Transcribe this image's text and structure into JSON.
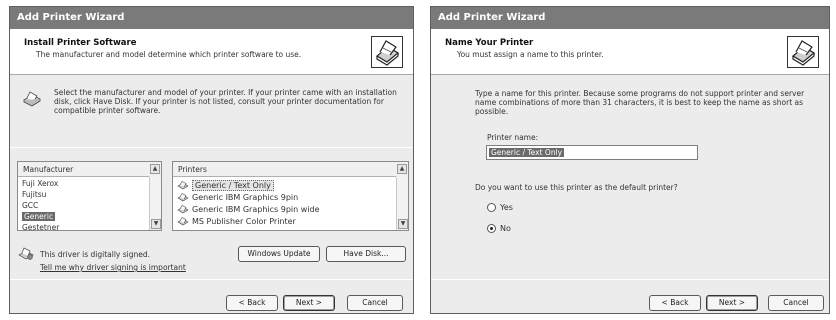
{
  "left": {
    "title": "Add Printer Wizard",
    "header_title": "Install Printer Software",
    "header_sub": "The manufacturer and model determine which printer software to use.",
    "instructions": "Select the manufacturer and model of your printer. If your printer came with an installation disk, click Have Disk. If your printer is not listed, consult your printer documentation for compatible printer software.",
    "manufacturer_header": "Manufacturer",
    "manufacturers": [
      "Fuji Xerox",
      "Fujitsu",
      "GCC",
      "Generic",
      "Gestetner"
    ],
    "selected_manufacturer": "Generic",
    "printers_header": "Printers",
    "printers": [
      "Generic / Text Only",
      "Generic IBM Graphics 9pin",
      "Generic IBM Graphics 9pin wide",
      "MS Publisher Color Printer"
    ],
    "selected_printer": "Generic / Text Only",
    "signed_text": "This driver is digitally signed.",
    "signing_link": "Tell me why driver signing is important",
    "windows_update_label": "Windows Update",
    "have_disk_label": "Have Disk...",
    "back_label": "< Back",
    "next_label": "Next >",
    "cancel_label": "Cancel"
  },
  "right": {
    "title": "Add Printer Wizard",
    "header_title": "Name Your Printer",
    "header_sub": "You must assign a name to this printer.",
    "instructions": "Type a name for this printer. Because some programs do not support printer and server name combinations of more than 31 characters, it is best to keep the name as short as possible.",
    "printer_name_label": "Printer name:",
    "printer_name_value": "Generic / Text Only",
    "default_question": "Do you want to use this printer as the default printer?",
    "yes_label": "Yes",
    "no_label": "No",
    "default_selected": "No",
    "back_label": "< Back",
    "next_label": "Next >",
    "cancel_label": "Cancel"
  },
  "icons": {
    "wizard": "printer-wizard-icon",
    "printer_small": "printer-icon",
    "signed": "driver-signed-icon"
  },
  "colors": {
    "titlebar": "#7a7a7a",
    "selection": "#6a6a6a",
    "dialog_bg": "#ececec"
  }
}
